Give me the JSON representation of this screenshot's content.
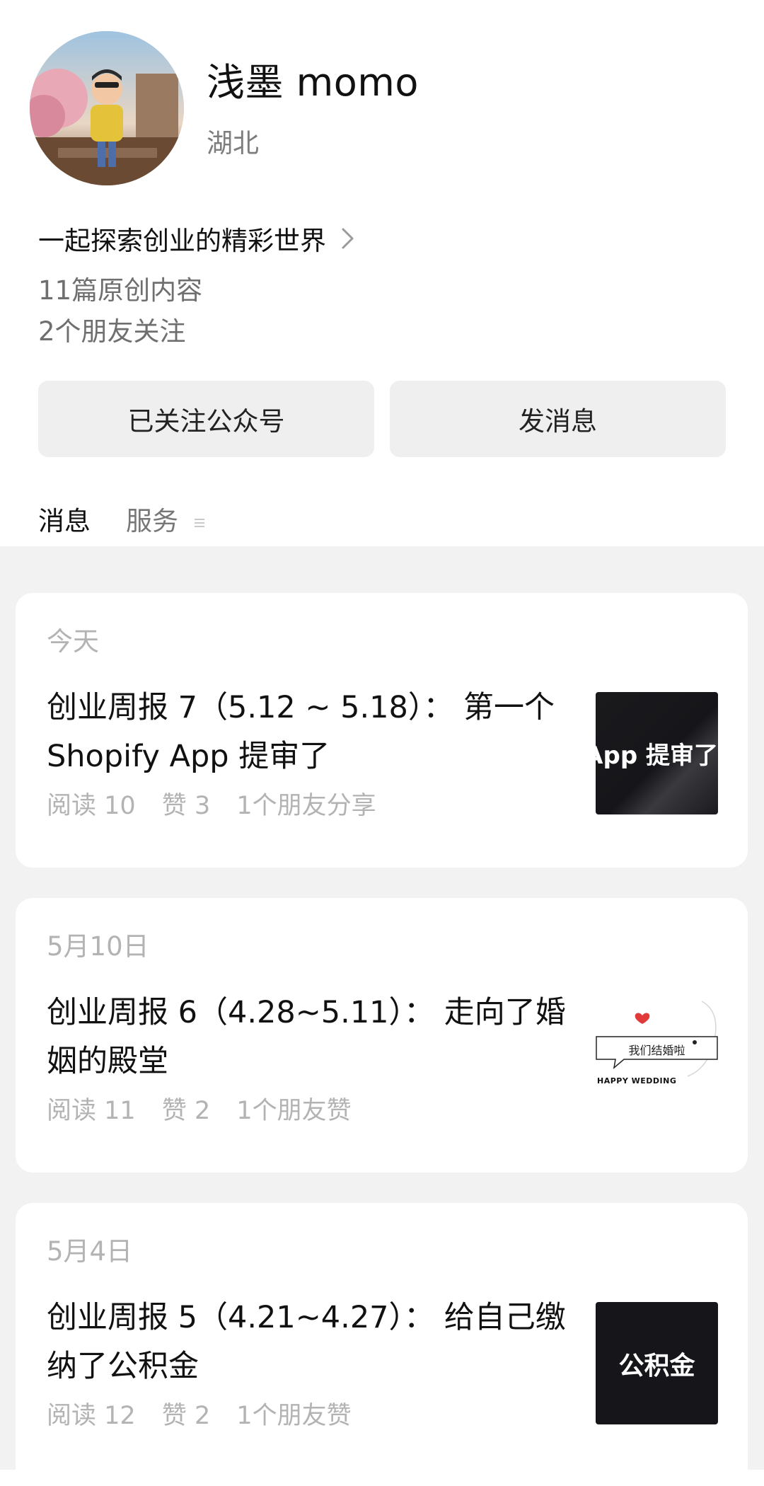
{
  "profile": {
    "name": "浅墨 momo",
    "location": "湖北",
    "bio": "一起探索创业的精彩世界",
    "original_count": "11篇原创内容",
    "friends_follow": "2个朋友关注"
  },
  "actions": {
    "follow_label": "已关注公众号",
    "message_label": "发消息"
  },
  "tabs": [
    {
      "label": "消息",
      "active": true
    },
    {
      "label": "服务",
      "active": false
    }
  ],
  "articles": [
    {
      "date": "今天",
      "title": "创业周报 7（5.12 ~ 5.18）：  第一个 Shopify App 提审了",
      "read": "阅读 10",
      "likes": "赞 3",
      "social": "1个朋友分享",
      "thumb_text": "App 提审了",
      "thumb_style": "dark"
    },
    {
      "date": "5月10日",
      "title": "创业周报 6（4.28~5.11）：  走向了婚姻的殿堂",
      "read": "阅读 11",
      "likes": "赞 2",
      "social": "1个朋友赞",
      "thumb_text": "我们结婚啦",
      "thumb_subtext": "HAPPY WEDDING",
      "thumb_style": "light"
    },
    {
      "date": "5月4日",
      "title": "创业周报 5（4.21~4.27）：  给自己缴纳了公积金",
      "read": "阅读 12",
      "likes": "赞 2",
      "social": "1个朋友赞",
      "thumb_text": "公积金",
      "thumb_style": "dark"
    }
  ],
  "colors": {
    "background": "#ffffff",
    "feed_background": "#f2f2f2",
    "button_bg": "#efefef",
    "muted_text": "#b3b3b3",
    "thumb_dark": "#18181b",
    "heart_red": "#e03a3a"
  }
}
